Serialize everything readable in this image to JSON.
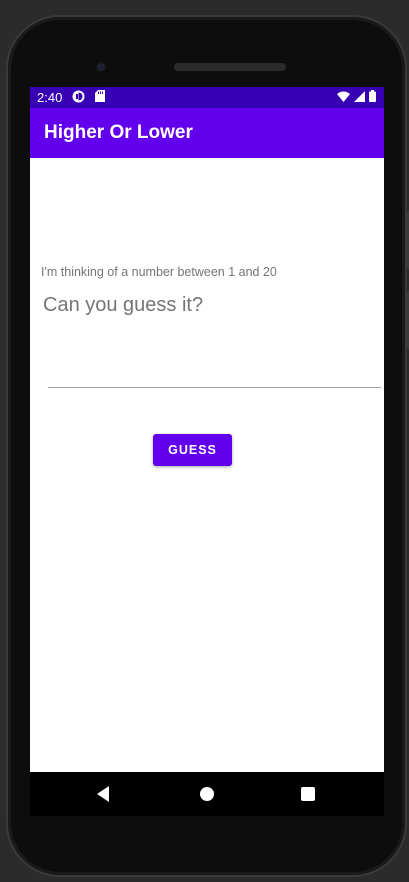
{
  "status_bar": {
    "time": "2:40",
    "icons": [
      "app-notification-icon",
      "sd-card-icon",
      "wifi-icon",
      "signal-icon",
      "battery-icon"
    ]
  },
  "app_bar": {
    "title": "Higher Or Lower"
  },
  "main": {
    "prompt": "I'm thinking of a number between 1 and 20",
    "guess_input": {
      "value": "",
      "placeholder": "Can you guess it?"
    },
    "guess_button_label": "GUESS"
  },
  "nav_bar": {
    "buttons": [
      "back-icon",
      "home-icon",
      "recents-icon"
    ]
  },
  "colors": {
    "primary": "#6200ee",
    "primary_dark": "#3700b3",
    "hint_text": "#757575"
  }
}
